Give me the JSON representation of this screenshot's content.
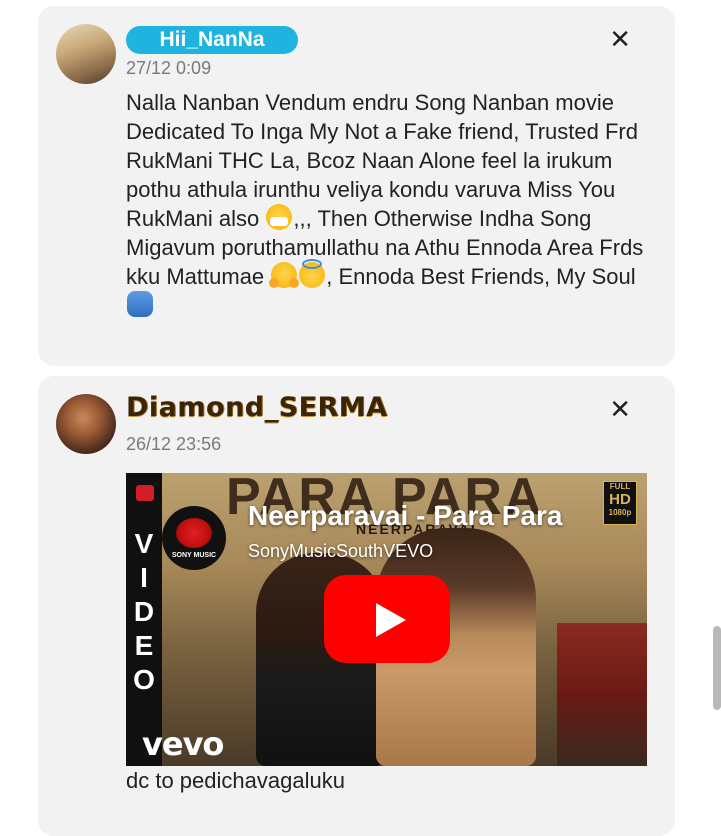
{
  "posts": [
    {
      "username": "Hii_NanNa",
      "timestamp": "27/12 0:09",
      "close_icon": "close-icon",
      "avatar": "avatar-photo",
      "text_parts": {
        "p1": "Nalla Nanban Vendum endru Song Nanban movie Dedicated To Inga My Not a Fake friend, Trusted Frd RukMani THC La, Bcoz Naan Alone feel la irukum pothu athula irunthu veliya kondu varuva Miss You RukMani also ",
        "p2": ",,, Then Otherwise Indha Song Migavum poruthamullathu na Athu Ennoda Area Frds kku Mattumae ",
        "p3": ", Ennoda Best Friends, My Soul "
      },
      "emojis": [
        "sneezing-face-emoji",
        "hugging-face-emoji",
        "smiling-face-with-halo-emoji",
        "people-hugging-emoji"
      ]
    },
    {
      "username": "Diamond_SERMA",
      "timestamp": "26/12 23:56",
      "close_icon": "close-icon",
      "avatar": "avatar-photo",
      "video": {
        "title": "Neerparavai - Para Para",
        "channel": "SonyMusicSouthVEVO",
        "background_title": "PARA PARA",
        "background_subtitle": "NEERPARAVAI",
        "side_letters": [
          "V",
          "I",
          "D",
          "E",
          "O"
        ],
        "logo_label": "SONY MUSIC",
        "hd_badge_top": "FULL",
        "hd_badge_mid": "HD",
        "hd_badge_bottom": "1080p",
        "watermark": "vevo",
        "play_icon": "youtube-play-icon"
      },
      "caption": "dc to pedichavagaluku"
    }
  ],
  "colors": {
    "card_bg": "#f2f2f2",
    "badge_bg": "#1fb4e0",
    "timestamp": "#7a7a7a",
    "play_button": "#ff0000"
  }
}
